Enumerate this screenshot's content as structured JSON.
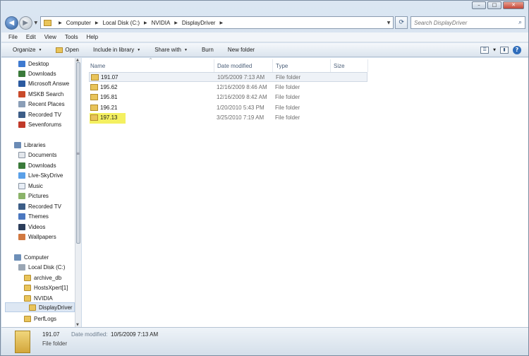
{
  "window": {
    "controls": [
      "–",
      "□",
      "✕"
    ]
  },
  "nav": {
    "back": "◀",
    "forward": "▶",
    "breadcrumb": [
      "Computer",
      "Local Disk (C:)",
      "NVIDIA",
      "DisplayDriver"
    ],
    "search_placeholder": "Search DisplayDriver"
  },
  "menu": [
    "File",
    "Edit",
    "View",
    "Tools",
    "Help"
  ],
  "toolbar": {
    "organize": "Organize",
    "open": "Open",
    "include_library": "Include in library",
    "share_with": "Share with",
    "burn": "Burn",
    "new_folder": "New folder"
  },
  "tree": [
    {
      "label": "Desktop",
      "icon": "desktop-icon"
    },
    {
      "label": "Downloads",
      "icon": "downloads-icon"
    },
    {
      "label": "Microsoft Answe",
      "icon": "document-icon"
    },
    {
      "label": "MSKB Search",
      "icon": "search-app-icon"
    },
    {
      "label": "Recent Places",
      "icon": "recent-places-icon"
    },
    {
      "label": "Recorded TV",
      "icon": "recorded-tv-icon"
    },
    {
      "label": "Sevenforums",
      "icon": "sevenforums-icon"
    },
    {
      "label": "Libraries",
      "icon": "libraries-icon"
    },
    {
      "label": "Documents",
      "icon": "documents-icon"
    },
    {
      "label": "Downloads",
      "icon": "downloads-icon"
    },
    {
      "label": "Live-SkyDrive",
      "icon": "skydrive-icon"
    },
    {
      "label": "Music",
      "icon": "music-icon"
    },
    {
      "label": "Pictures",
      "icon": "pictures-icon"
    },
    {
      "label": "Recorded TV",
      "icon": "recorded-tv-icon"
    },
    {
      "label": "Themes",
      "icon": "themes-icon"
    },
    {
      "label": "Videos",
      "icon": "videos-icon"
    },
    {
      "label": "Wallpapers",
      "icon": "wallpapers-icon"
    },
    {
      "label": "Computer",
      "icon": "computer-icon"
    },
    {
      "label": "Local Disk (C:)",
      "icon": "disk-icon"
    },
    {
      "label": "archive_db",
      "icon": "folder-icon"
    },
    {
      "label": "HostsXpert[1]",
      "icon": "folder-icon"
    },
    {
      "label": "NVIDIA",
      "icon": "folder-icon"
    },
    {
      "label": "DisplayDriver",
      "icon": "folder-icon"
    },
    {
      "label": "PerfLogs",
      "icon": "folder-icon"
    }
  ],
  "columns": [
    "Name",
    "Date modified",
    "Type",
    "Size"
  ],
  "files": [
    {
      "name": "191.07",
      "date": "10/5/2009 7:13 AM",
      "type": "File folder"
    },
    {
      "name": "195.62",
      "date": "12/16/2009 8:46 AM",
      "type": "File folder"
    },
    {
      "name": "195.81",
      "date": "12/16/2009 8:42 AM",
      "type": "File folder"
    },
    {
      "name": "196.21",
      "date": "1/20/2010 5:43 PM",
      "type": "File folder"
    },
    {
      "name": "197.13",
      "date": "3/25/2010 7:19 AM",
      "type": "File folder"
    }
  ],
  "details": {
    "name": "191.07",
    "date_label": "Date modified:",
    "date_value": "10/5/2009 7:13 AM",
    "type": "File folder"
  },
  "colors": {
    "highlight": "#f4f060",
    "accent": "#2f6dbb"
  }
}
